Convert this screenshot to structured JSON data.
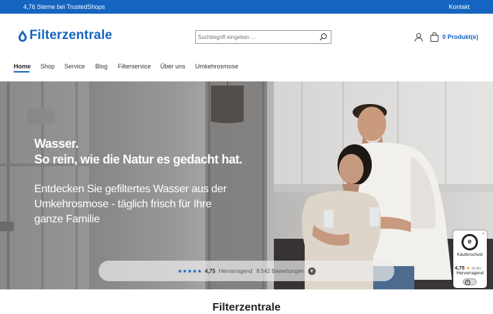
{
  "topbar": {
    "rating_text": "4,76 Sterne bei TrustedShops",
    "contact": "Kontakt"
  },
  "header": {
    "logo_text": "Filterzentrale",
    "search_placeholder": "Suchbegriff eingeben ...",
    "cart_text": "0 Produkt(e)",
    "icons": [
      "search-icon",
      "user-icon",
      "cart-icon"
    ]
  },
  "nav": {
    "items": [
      "Home",
      "Shop",
      "Service",
      "Blog",
      "Filterservice",
      "Über uns",
      "Umkehrosmose"
    ],
    "active": "Home"
  },
  "hero": {
    "headline_1": "Wasser.",
    "headline_2": "So rein, wie die Natur es gedacht hat.",
    "subline": "Entdecken Sie gefiltertes Wasser aus der Umkehrosmose - täglich frisch für Ihre ganze Familie"
  },
  "rating_bar": {
    "stars": "★★★★★",
    "score": "4,75",
    "label": "Hervorragend",
    "reviews": "8.542 Bewertungen"
  },
  "trust_widget": {
    "title": "Käuferschutz",
    "score": "4,75",
    "count": "(8.5k)",
    "grade": "Hervorragend"
  },
  "section": {
    "title": "Filterzentrale"
  },
  "colors": {
    "brand": "#1565c0",
    "topbar": "#1565c0",
    "star": "#f2a100"
  }
}
